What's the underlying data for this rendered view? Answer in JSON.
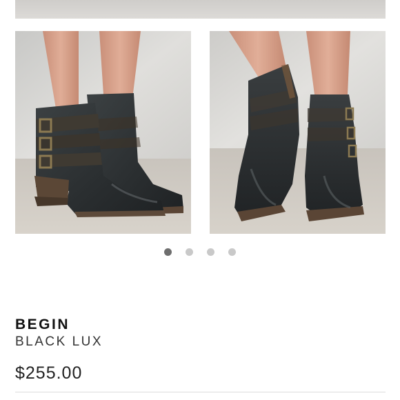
{
  "product": {
    "brand": "BEGIN",
    "color": "BLACK LUX",
    "price": "$255.00"
  },
  "gallery": {
    "images": [
      {
        "name": "side-view"
      },
      {
        "name": "front-view"
      }
    ],
    "total_slides": 4,
    "active_slide": 1
  },
  "colors": {
    "dot_active": "#6e6e6e",
    "dot_inactive": "#c9c9c9",
    "leather": "#2e3133"
  }
}
